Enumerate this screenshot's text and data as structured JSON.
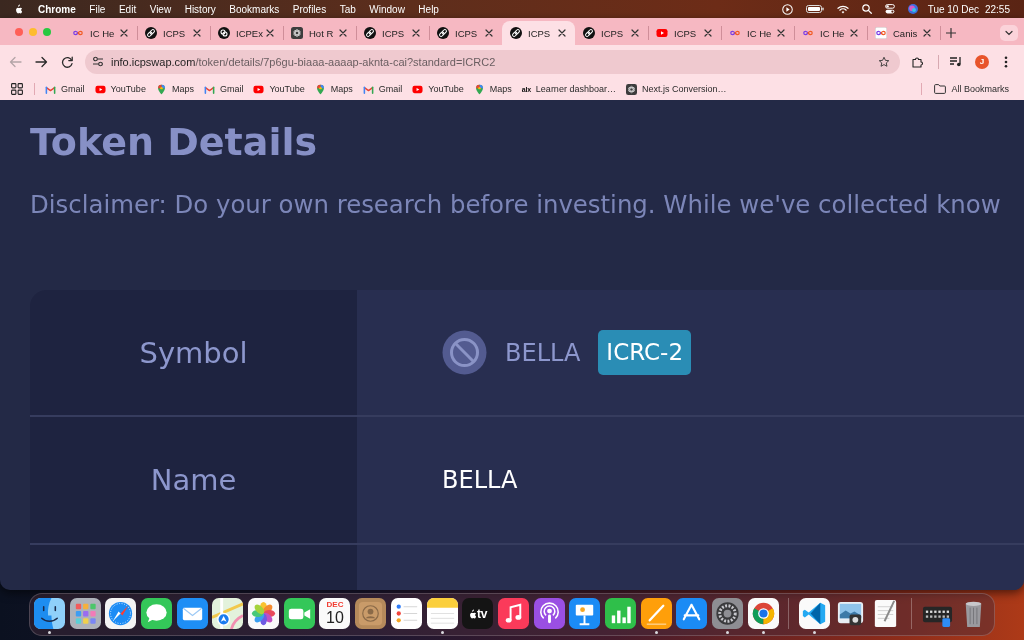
{
  "menu_bar": {
    "app": "Chrome",
    "items": [
      "File",
      "Edit",
      "View",
      "History",
      "Bookmarks",
      "Profiles",
      "Tab",
      "Window",
      "Help"
    ],
    "date": "Tue 10 Dec",
    "time": "22:55"
  },
  "tabs": [
    {
      "title": "IC He",
      "kind": "infinity",
      "selected": false
    },
    {
      "title": "ICPS",
      "kind": "link",
      "selected": false
    },
    {
      "title": "ICPEx",
      "kind": "rings",
      "selected": false
    },
    {
      "title": "Hot R",
      "kind": "rosette",
      "selected": false
    },
    {
      "title": "ICPS",
      "kind": "link",
      "selected": false
    },
    {
      "title": "ICPS",
      "kind": "link",
      "selected": false
    },
    {
      "title": "ICPS",
      "kind": "link",
      "selected": true
    },
    {
      "title": "ICPS",
      "kind": "link",
      "selected": false
    },
    {
      "title": "ICPS",
      "kind": "video",
      "selected": false
    },
    {
      "title": "IC He",
      "kind": "infinity",
      "selected": false
    },
    {
      "title": "IC He",
      "kind": "infinity",
      "selected": false
    },
    {
      "title": "Canis",
      "kind": "framed",
      "selected": false
    }
  ],
  "toolbar": {
    "back": {
      "disabled": true
    },
    "forward": {
      "disabled": false
    },
    "address": {
      "host": "info.icpswap.com",
      "path": "/token/details/7p6gu-biaaa-aaaap-aknta-cai?standard=ICRC2"
    },
    "profile": {
      "initial": "J"
    }
  },
  "bookmarks": [
    {
      "title": "Gmail",
      "kind": "mail"
    },
    {
      "title": "YouTube",
      "kind": "video"
    },
    {
      "title": "Maps",
      "kind": "pin"
    },
    {
      "title": "Gmail",
      "kind": "mail"
    },
    {
      "title": "YouTube",
      "kind": "video"
    },
    {
      "title": "Maps",
      "kind": "pin"
    },
    {
      "title": "Gmail",
      "kind": "mail"
    },
    {
      "title": "YouTube",
      "kind": "video"
    },
    {
      "title": "Maps",
      "kind": "pin"
    },
    {
      "title": "Learner dashboar…",
      "kind": "wordmark",
      "mark": "alx"
    },
    {
      "title": "Next.js Conversion…",
      "kind": "rosette"
    }
  ],
  "all_bookmarks": "All Bookmarks",
  "page": {
    "title": "Token Details",
    "disclaimer": "Disclaimer: Do your own research before investing. While we've collected know",
    "rows": [
      {
        "label": "Symbol",
        "kind": "symbol",
        "value": "BELLA",
        "standard": "ICRC-2"
      },
      {
        "label": "Name",
        "kind": "text",
        "value": "BELLA"
      }
    ]
  },
  "dock": {
    "sections": [
      {
        "items": [
          {
            "kind": "face",
            "running": true
          },
          {
            "kind": "grid",
            "running": false
          },
          {
            "kind": "compass",
            "running": false
          },
          {
            "kind": "bubble",
            "running": false
          },
          {
            "kind": "envelope",
            "running": false
          },
          {
            "kind": "map",
            "running": false
          },
          {
            "kind": "flower",
            "running": false
          },
          {
            "kind": "camera",
            "running": false
          },
          {
            "kind": "calendar",
            "running": false,
            "month": "DEC",
            "day": "10"
          },
          {
            "kind": "contact",
            "running": false
          },
          {
            "kind": "checklist",
            "running": false
          },
          {
            "kind": "notepad",
            "running": true
          },
          {
            "kind": "tv",
            "running": false,
            "label": "tv"
          },
          {
            "kind": "note",
            "running": false
          },
          {
            "kind": "podcast",
            "running": false
          },
          {
            "kind": "lectern",
            "running": false
          },
          {
            "kind": "chart",
            "running": false
          },
          {
            "kind": "pen",
            "running": true
          },
          {
            "kind": "store",
            "running": false
          },
          {
            "kind": "gear",
            "running": true
          },
          {
            "kind": "browser",
            "running": true
          }
        ]
      },
      {
        "items": [
          {
            "kind": "editor",
            "running": true
          },
          {
            "kind": "viewer",
            "running": false
          },
          {
            "kind": "document",
            "running": false
          }
        ]
      },
      {
        "items": [
          {
            "kind": "stack",
            "running": false
          },
          {
            "kind": "trash",
            "running": false
          }
        ]
      }
    ]
  }
}
